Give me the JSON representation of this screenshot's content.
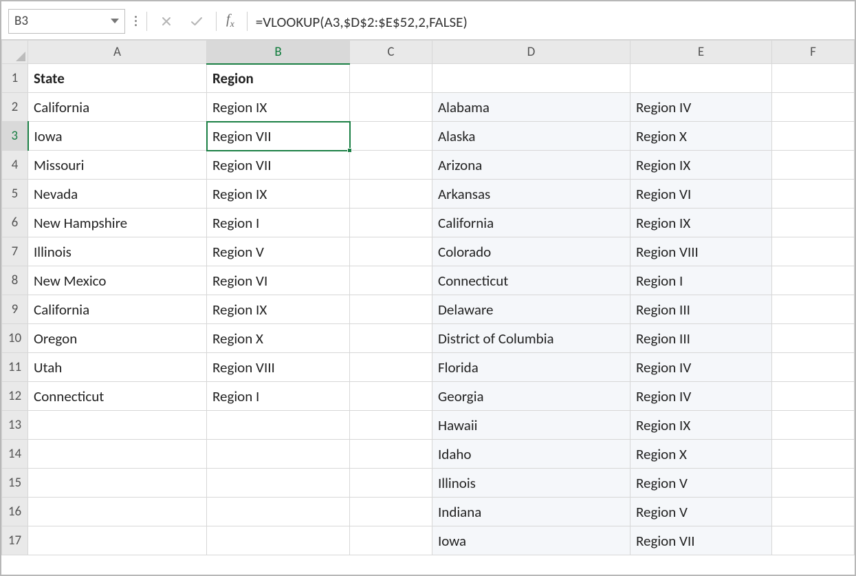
{
  "nameBox": {
    "value": "B3"
  },
  "formulaBar": {
    "value": "=VLOOKUP(A3,$D$2:$E$52,2,FALSE)"
  },
  "columnHeaders": [
    "A",
    "B",
    "C",
    "D",
    "E",
    "F"
  ],
  "selectedColumnIndex": 1,
  "selectedRowNumber": 3,
  "rows": [
    {
      "n": 1,
      "A": "State",
      "B": "Region",
      "C": "",
      "D": "",
      "E": "",
      "bold": true
    },
    {
      "n": 2,
      "A": "California",
      "B": "Region IX",
      "C": "",
      "D": "Alabama",
      "E": "Region IV"
    },
    {
      "n": 3,
      "A": "Iowa",
      "B": "Region VII",
      "C": "",
      "D": "Alaska",
      "E": "Region X"
    },
    {
      "n": 4,
      "A": "Missouri",
      "B": "Region VII",
      "C": "",
      "D": "Arizona",
      "E": "Region IX"
    },
    {
      "n": 5,
      "A": "Nevada",
      "B": "Region IX",
      "C": "",
      "D": "Arkansas",
      "E": "Region VI"
    },
    {
      "n": 6,
      "A": "New Hampshire",
      "B": "Region I",
      "C": "",
      "D": "California",
      "E": "Region IX"
    },
    {
      "n": 7,
      "A": "Illinois",
      "B": "Region V",
      "C": "",
      "D": "Colorado",
      "E": "Region VIII"
    },
    {
      "n": 8,
      "A": "New Mexico",
      "B": "Region VI",
      "C": "",
      "D": "Connecticut",
      "E": "Region I"
    },
    {
      "n": 9,
      "A": "California",
      "B": "Region IX",
      "C": "",
      "D": "Delaware",
      "E": "Region III"
    },
    {
      "n": 10,
      "A": "Oregon",
      "B": "Region X",
      "C": "",
      "D": "District of Columbia",
      "E": "Region III"
    },
    {
      "n": 11,
      "A": "Utah",
      "B": "Region VIII",
      "C": "",
      "D": "Florida",
      "E": "Region IV"
    },
    {
      "n": 12,
      "A": "Connecticut",
      "B": "Region I",
      "C": "",
      "D": "Georgia",
      "E": "Region IV"
    },
    {
      "n": 13,
      "A": "",
      "B": "",
      "C": "",
      "D": "Hawaii",
      "E": "Region IX"
    },
    {
      "n": 14,
      "A": "",
      "B": "",
      "C": "",
      "D": "Idaho",
      "E": "Region X"
    },
    {
      "n": 15,
      "A": "",
      "B": "",
      "C": "",
      "D": "Illinois",
      "E": "Region V"
    },
    {
      "n": 16,
      "A": "",
      "B": "",
      "C": "",
      "D": "Indiana",
      "E": "Region V"
    },
    {
      "n": 17,
      "A": "",
      "B": "",
      "C": "",
      "D": "Iowa",
      "E": "Region VII"
    }
  ],
  "selection": {
    "cell": "B3"
  }
}
